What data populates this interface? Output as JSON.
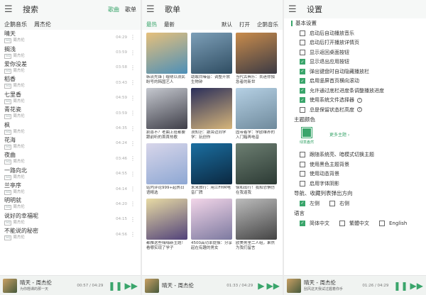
{
  "search_panel": {
    "title": "搜索",
    "tabs": [
      "歌曲",
      "歌单"
    ],
    "active_tab": 0,
    "source_line": [
      "企鹅音乐",
      "周杰伦"
    ],
    "songs": [
      {
        "name": "晴天",
        "quality": "SQ",
        "artist": "周杰伦",
        "duration": "04:29"
      },
      {
        "name": "搁浅",
        "quality": "SQ",
        "artist": "周杰伦",
        "duration": "03:59"
      },
      {
        "name": "爱你没差",
        "quality": "SQ",
        "artist": "周杰伦",
        "duration": "03:58"
      },
      {
        "name": "稻香",
        "quality": "SQ",
        "artist": "周杰伦",
        "duration": "03:43"
      },
      {
        "name": "七里香",
        "quality": "SQ",
        "artist": "周杰伦",
        "duration": "04:59"
      },
      {
        "name": "青花瓷",
        "quality": "SQ",
        "artist": "周杰伦",
        "duration": "03:59"
      },
      {
        "name": "枫",
        "quality": "SQ",
        "artist": "周杰伦",
        "duration": "04:35"
      },
      {
        "name": "花海",
        "quality": "SQ",
        "artist": "周杰伦",
        "duration": "04:24"
      },
      {
        "name": "夜曲",
        "quality": "SQ",
        "artist": "周杰伦",
        "duration": "03:46"
      },
      {
        "name": "一路向北",
        "quality": "SQ",
        "artist": "周杰伦",
        "duration": "04:55"
      },
      {
        "name": "兰亭序",
        "quality": "SQ",
        "artist": "周杰伦",
        "duration": "04:14"
      },
      {
        "name": "明明就",
        "quality": "SQ",
        "artist": "周杰伦",
        "duration": "04:20"
      },
      {
        "name": "说好的幸福呢",
        "quality": "SQ",
        "artist": "周杰伦",
        "duration": "04:15"
      },
      {
        "name": "不能说的秘密",
        "quality": "SQ",
        "artist": "周杰伦",
        "duration": "04:56"
      }
    ]
  },
  "playlist_panel": {
    "title": "歌单",
    "filters": [
      "最热",
      "最新"
    ],
    "active_filter": 0,
    "right_options": [
      "默认",
      "打开",
      "企鹅音乐"
    ],
    "cards": [
      {
        "caption": "韩流先锋 | 缠绕以浪民盼号的韩国艺人",
        "colors": [
          "#e6c07b",
          "#4c8fb8"
        ]
      },
      {
        "caption": "助眠白噪音：调整开放生物钟",
        "colors": [
          "#7d9fb8",
          "#2f4d62"
        ]
      },
      {
        "caption": "当代古典乐：去迷你独急者的新世",
        "colors": [
          "#c98c4c",
          "#3b3a44"
        ]
      },
      {
        "caption": "割喜不？老曲上班都要跟前听的首首热歌",
        "colors": [
          "#c5c8cf",
          "#3e3e48"
        ]
      },
      {
        "caption": "浪知识：跟旁边同学学：玩创作",
        "colors": [
          "#2b2f5a",
          "#d6b57a"
        ]
      },
      {
        "caption": "固带着学：学欧维养的入门箱再电音",
        "colors": [
          "#b5d0e4",
          "#6f8a9c"
        ]
      },
      {
        "caption": "站内评论999+起热日语精选",
        "colors": [
          "#d8d6ea",
          "#8da7d3"
        ]
      },
      {
        "caption": "未来旅行：用兰FHM电音厂牌",
        "colors": [
          "#1b6fa1",
          "#0b2840"
        ]
      },
      {
        "caption": "徐和出行！我和恐惧仿在我逼我",
        "colors": [
          "#6d7f72",
          "#2c3a34"
        ]
      },
      {
        "caption": "都推这些嗨嗨新主题！看哪实现了学子",
        "colors": [
          "#e8dba4",
          "#51427a"
        ]
      },
      {
        "caption": "4500高功率提振：分享起在有趣的男女",
        "colors": [
          "#f2d5e8",
          "#7d7aa0"
        ]
      },
      {
        "caption": "欧美男里二人组，果然为我们留言",
        "colors": [
          "#bcbcbc",
          "#444"
        ]
      }
    ]
  },
  "settings_panel": {
    "title": "设置",
    "section_basic": "基本设置",
    "basic_options": [
      {
        "label": "启动后自动播放音乐",
        "checked": false,
        "help": false
      },
      {
        "label": "启动后打开播放详情页",
        "checked": false,
        "help": false
      },
      {
        "label": "显示返回桌面按钮",
        "checked": false,
        "help": false
      },
      {
        "label": "显示退出应用按钮",
        "checked": true,
        "help": false
      },
      {
        "label": "弹出键盘时自动隐藏播放栏",
        "checked": true,
        "help": false
      },
      {
        "label": "启用竖屏首页横向滚动",
        "checked": true,
        "help": false
      },
      {
        "label": "允许通过底栏进度条调整播放进度",
        "checked": true,
        "help": false
      },
      {
        "label": "使用系统文件选择器",
        "checked": true,
        "help": true
      },
      {
        "label": "总是保留状态栏高度",
        "checked": false,
        "help": true
      }
    ],
    "section_theme": "主题颜色",
    "theme_label": "绿意盎然",
    "more_theme": "更多主题 ›",
    "theme_options": [
      {
        "label": "跟随系统亮、暗模式切换主题",
        "checked": false
      },
      {
        "label": "使用黑色主题背景",
        "checked": false
      },
      {
        "label": "使用动态背景",
        "checked": false
      },
      {
        "label": "启用字体阴影",
        "checked": false
      }
    ],
    "section_nav": "导航、收藏列表弹出方向",
    "nav_options": [
      {
        "label": "左侧",
        "checked": true
      },
      {
        "label": "右侧",
        "checked": false
      }
    ],
    "section_lang": "语言",
    "lang_options": [
      {
        "label": "简体中文",
        "checked": true
      },
      {
        "label": "繁體中文",
        "checked": false
      },
      {
        "label": "English",
        "checked": false
      }
    ]
  },
  "players": [
    {
      "title": "晴天 - 周杰伦",
      "lyric": "为你翘课的那一天",
      "time": "00:57 / 04:29",
      "progress": 0.21
    },
    {
      "title": "晴天 - 周杰伦",
      "lyric": "",
      "time": "01:33 / 04:29",
      "progress": 0.35
    },
    {
      "title": "晴天 - 周杰伦",
      "lyric": "刮风这天我试过握着你手",
      "time": "01:26 / 04:29",
      "progress": 0.32
    }
  ],
  "colors": {
    "accent": "#3aa56b"
  }
}
